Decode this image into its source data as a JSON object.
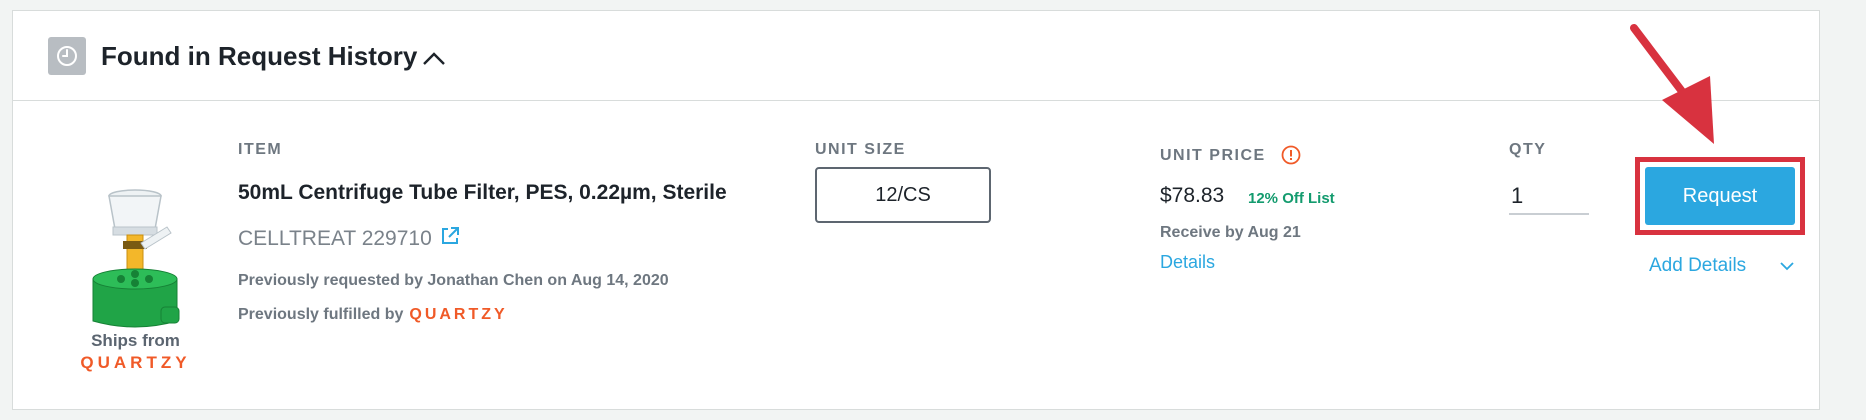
{
  "header": {
    "icon": "clock-icon",
    "title": "Found in Request History",
    "toggle_icon": "chevron-up-icon"
  },
  "columns": {
    "item_label": "ITEM",
    "unit_size_label": "UNIT SIZE",
    "unit_price_label": "UNIT PRICE",
    "qty_label": "QTY"
  },
  "item": {
    "name": "50mL Centrifuge Tube Filter, PES, 0.22µm, Sterile",
    "catalog": "CELLTREAT 229710",
    "catalog_link_icon": "external-link-icon",
    "previously_requested": "Previously requested by Jonathan Chen on Aug 14, 2020",
    "previously_fulfilled_prefix": "Previously fulfilled by",
    "fulfilled_brand": "QUARTZY",
    "image": "centrifuge-tube-filter-image"
  },
  "shipping": {
    "ships_from_label": "Ships from",
    "brand": "QUARTZY"
  },
  "unit_size": {
    "value": "12/CS"
  },
  "pricing": {
    "price": "$78.83",
    "discount": "12% Off List",
    "receive_by": "Receive by Aug 21",
    "details_link": "Details",
    "info_icon": "alert-circle-icon"
  },
  "qty": {
    "value": "1"
  },
  "actions": {
    "request_label": "Request",
    "add_details_label": "Add Details",
    "add_details_icon": "chevron-down-icon"
  },
  "annotation": {
    "arrow_color": "#d8323f",
    "highlight_color": "#d8323f"
  },
  "colors": {
    "accent": "#2ba7e0",
    "brand": "#f05a28",
    "discount": "#139b6e"
  }
}
